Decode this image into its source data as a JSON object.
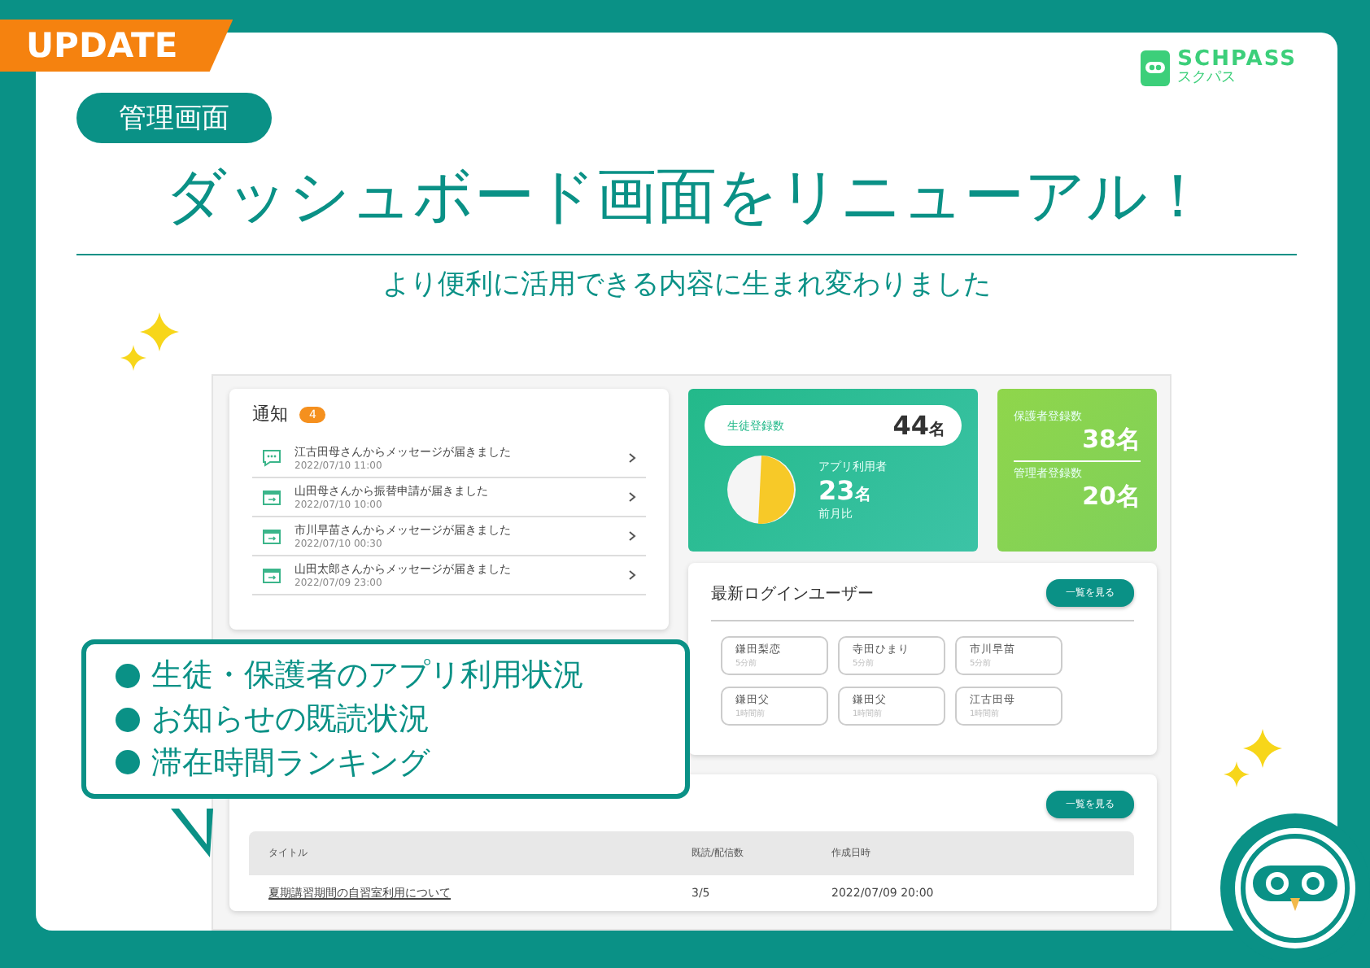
{
  "badge": "UPDATE",
  "logo": {
    "name": "SCHPASS",
    "kana": "スクパス"
  },
  "category": "管理画面",
  "headline": "ダッシュボード画面をリニューアル！",
  "subheadline": "より便利に活用できる内容に生まれ変わりました",
  "notifications": {
    "title": "通知",
    "count": "4",
    "items": [
      {
        "kind": "message",
        "text": "江古田母さんからメッセージが届きました",
        "time": "2022/07/10 11:00"
      },
      {
        "kind": "calendar",
        "text": "山田母さんから振替申請が届きました",
        "time": "2022/07/10 10:00"
      },
      {
        "kind": "calendar",
        "text": "市川早苗さんからメッセージが届きました",
        "time": "2022/07/10 00:30"
      },
      {
        "kind": "calendar",
        "text": "山田太郎さんからメッセージが届きました",
        "time": "2022/07/09 23:00"
      }
    ]
  },
  "student_stats": {
    "label": "生徒登録数",
    "value": "44",
    "unit": "名",
    "app_label": "アプリ利用者",
    "app_value": "23",
    "app_unit": "名",
    "compare": "前月比"
  },
  "member_stats": [
    {
      "label": "保護者登録数",
      "value": "38",
      "unit": "名"
    },
    {
      "label": "管理者登録数",
      "value": "20",
      "unit": "名"
    }
  ],
  "recent_logins": {
    "title": "最新ログインユーザー",
    "button": "一覧を見る",
    "users": [
      {
        "name": "鎌田梨恋",
        "time": "5分前"
      },
      {
        "name": "寺田ひまり",
        "time": "5分前"
      },
      {
        "name": "市川早苗",
        "time": "5分前"
      },
      {
        "name": "鎌田父",
        "time": "1時間前"
      },
      {
        "name": "鎌田父",
        "time": "1時間前"
      },
      {
        "name": "江古田母",
        "time": "1時間前"
      }
    ]
  },
  "announcements": {
    "button": "一覧を見る",
    "columns": [
      "タイトル",
      "既読/配信数",
      "作成日時"
    ],
    "rows": [
      [
        "夏期講習期間の自習室利用について",
        "3/5",
        "2022/07/09 20:00"
      ]
    ]
  },
  "highlights": [
    "生徒・保護者のアプリ利用状況",
    "お知らせの既読状況",
    "滞在時間ランキング"
  ]
}
